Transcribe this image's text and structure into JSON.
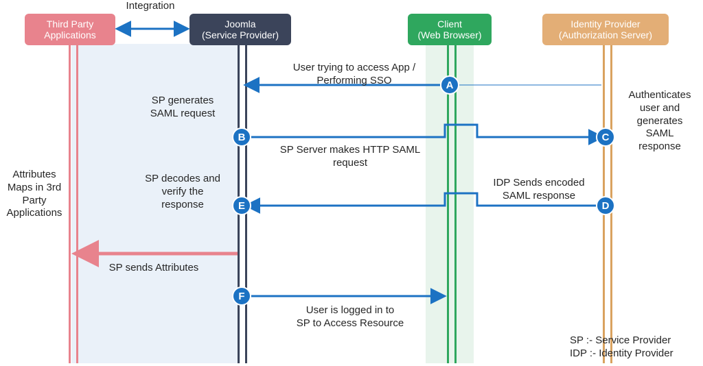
{
  "boxes": {
    "tp": "Third Party\nApplications",
    "sp": "Joomla\n(Service Provider)",
    "cl": "Client\n(Web Browser)",
    "idp": "Identity Provider\n(Authorization Server)"
  },
  "labels": {
    "integration": "Integration",
    "a": "User trying to access App /\nPerforming SSO",
    "sp_gen": "SP generates\nSAML request",
    "b": "SP Server makes HTTP SAML\nrequest",
    "c": "Authenticates\nuser and\ngenerates\nSAML\nresponse",
    "d": "IDP Sends encoded\nSAML response",
    "e": "SP decodes and\nverify the\nresponse",
    "attrs_side": "Attributes\nMaps in 3rd\nParty\nApplications",
    "sp_sends": "SP sends Attributes",
    "f": "User is logged in to\nSP to Access Resource",
    "legend": "SP :- Service Provider\nIDP :- Identity Provider"
  },
  "steps": {
    "A": "A",
    "B": "B",
    "C": "C",
    "D": "D",
    "E": "E",
    "F": "F"
  }
}
